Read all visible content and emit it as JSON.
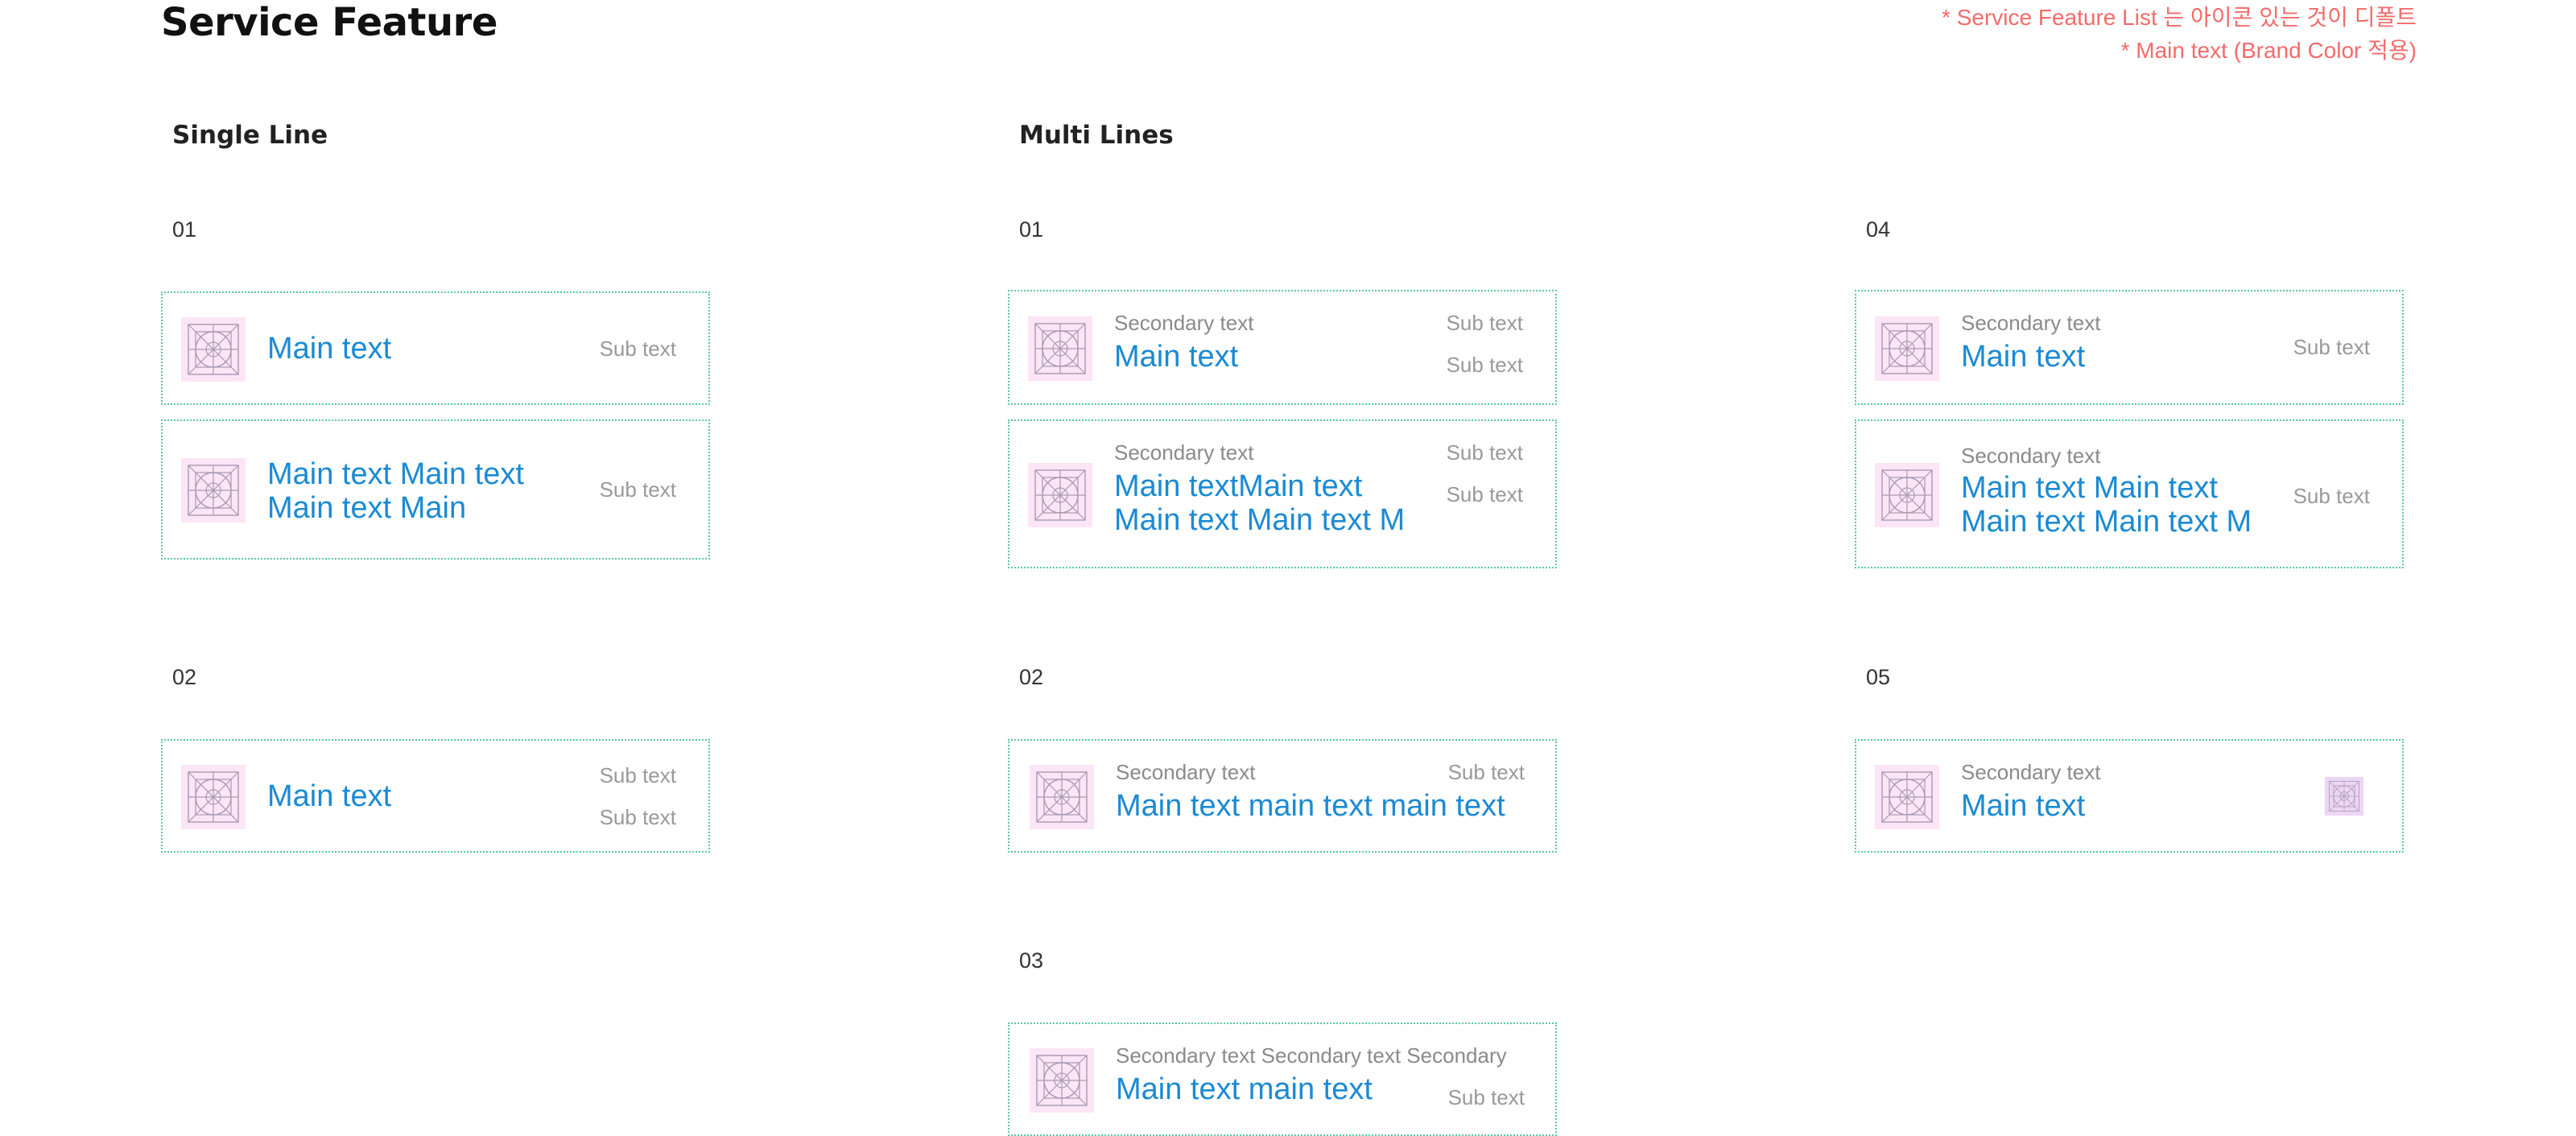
{
  "page": {
    "title": "Service Feature",
    "notes": [
      "* Service Feature List 는 아이콘 있는 것이 디폴트",
      "* Main text (Brand Color 적용)"
    ]
  },
  "colors": {
    "brand_main_text": "#1b8ad3",
    "card_border": "#5cc7a2",
    "icon_background": "#fbe5f6",
    "note_text": "#f46b6b"
  },
  "icons": {
    "placeholder": "image-placeholder-icon"
  },
  "single_line": {
    "title": "Single Line",
    "items": [
      {
        "number": "01",
        "cards": [
          {
            "main": "Main text",
            "sub": "Sub text"
          },
          {
            "main_lines": [
              "Main text Main text",
              "Main text Main"
            ],
            "sub": "Sub text"
          }
        ]
      },
      {
        "number": "02",
        "cards": [
          {
            "main": "Main text",
            "subs": [
              "Sub text",
              "Sub text"
            ]
          }
        ]
      }
    ]
  },
  "multi_lines": {
    "title": "Multi Lines",
    "items": [
      {
        "number": "01",
        "cards": [
          {
            "secondary": "Secondary text",
            "main": "Main text",
            "subs": [
              "Sub text",
              "Sub text"
            ]
          },
          {
            "secondary": "Secondary text",
            "main_lines": [
              "Main textMain text",
              "Main text Main text M"
            ],
            "subs": [
              "Sub text",
              "Sub text"
            ]
          }
        ]
      },
      {
        "number": "02",
        "cards": [
          {
            "secondary": "Secondary text",
            "main": "Main text main text main text",
            "sub": "Sub text"
          }
        ]
      },
      {
        "number": "03",
        "cards": [
          {
            "secondary": "Secondary text Secondary text Secondary",
            "main": "Main text main text",
            "sub": "Sub text"
          }
        ]
      },
      {
        "number": "04",
        "cards": [
          {
            "secondary": "Secondary text",
            "main": "Main text",
            "sub": "Sub text"
          },
          {
            "secondary": "Secondary text",
            "main_lines": [
              "Main text Main text",
              "Main text Main text M"
            ],
            "sub": "Sub text"
          }
        ]
      },
      {
        "number": "05",
        "cards": [
          {
            "secondary": "Secondary text",
            "main": "Main text"
          }
        ]
      }
    ]
  }
}
